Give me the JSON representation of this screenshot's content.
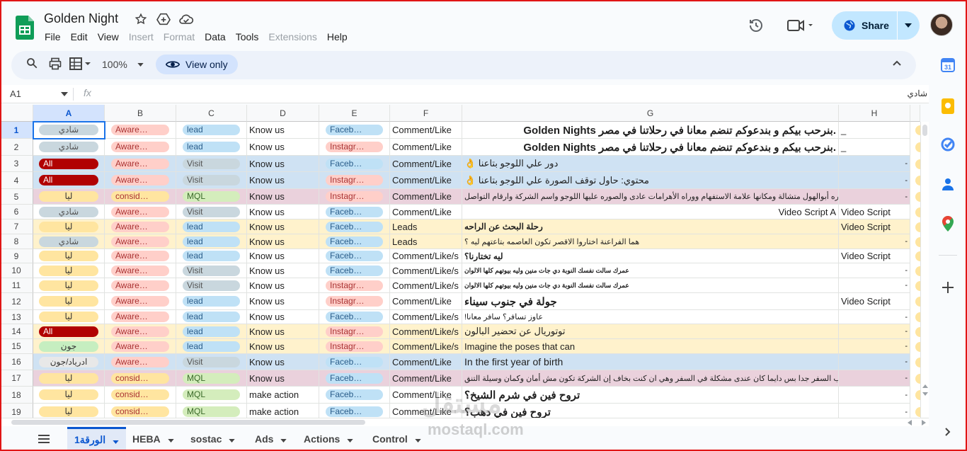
{
  "app": {
    "doc_title": "Golden Night",
    "menu": [
      {
        "label": "File",
        "disabled": false
      },
      {
        "label": "Edit",
        "disabled": false
      },
      {
        "label": "View",
        "disabled": false
      },
      {
        "label": "Insert",
        "disabled": true
      },
      {
        "label": "Format",
        "disabled": true
      },
      {
        "label": "Data",
        "disabled": false
      },
      {
        "label": "Tools",
        "disabled": false
      },
      {
        "label": "Extensions",
        "disabled": true
      },
      {
        "label": "Help",
        "disabled": false
      }
    ],
    "share_label": "Share"
  },
  "toolbar": {
    "zoom": "100%",
    "view_only_label": "View only"
  },
  "formula_bar": {
    "cell_ref": "A1",
    "fx": "fx",
    "value": "شادي"
  },
  "columns": [
    "A",
    "B",
    "C",
    "D",
    "E",
    "F",
    "G",
    "H"
  ],
  "rows": [
    {
      "n": "1",
      "a": "شادي",
      "b": "Aware…",
      "c": "lead",
      "d": "Know us",
      "e": "Faceb…",
      "f": "Comment/Like",
      "g": "Golden Nights بنرحب بيكم و بندعوكم تنضم معانا في رحلاتنا في مصر.",
      "g_style": "bold",
      "h": "_"
    },
    {
      "n": "2",
      "a": "شادي",
      "b": "Aware…",
      "c": "lead",
      "d": "Know us",
      "e": "Instagr…",
      "f": "Comment/Like",
      "g": "Golden Nights بنرحب بيكم و بندعوكم تنضم معانا في رحلاتنا في مصر.",
      "g_style": "bold",
      "h": "_"
    },
    {
      "n": "3",
      "a": "All",
      "b": "Aware…",
      "c": "Visit",
      "d": "Know us",
      "e": "Faceb…",
      "f": "Comment/Like",
      "g": "دور علي اللوجو بتاعنا 👌",
      "g_style": "normal",
      "h": "-"
    },
    {
      "n": "4",
      "a": "All",
      "b": "Aware…",
      "c": "Visit",
      "d": "Know us",
      "e": "Instagr…",
      "f": "Comment/Like",
      "g": "محتوي: حاول توقف الصورة علي اللوجو بتاعنا 👌",
      "g_style": "normal",
      "h": "-"
    },
    {
      "n": "5",
      "a": "ليا",
      "b": "consid…",
      "c": "MQL",
      "d": "Know us",
      "e": "Instagr…",
      "f": "Comment/Like",
      "g": "صوره أبوالهول متشالة ومكانها علامة الاستفهام ووراه الأهرامات عادى والصوره عليها اللوجو واسم الشركة وارقام التواصل",
      "g_style": "small",
      "h": "-"
    },
    {
      "n": "6",
      "a": "شادي",
      "b": "Aware…",
      "c": "Visit",
      "d": "Know us",
      "e": "Faceb…",
      "f": "Comment/Like",
      "g": "Video Script A",
      "g_style": "normal",
      "h": "Video Script"
    },
    {
      "n": "7",
      "a": "ليا",
      "b": "Aware…",
      "c": "lead",
      "d": "Know us",
      "e": "Faceb…",
      "f": "Leads",
      "g": "رحلة البحث عن الراحه",
      "g_style": "boldsmall",
      "h": "Video Script",
      "g_align": "left"
    },
    {
      "n": "8",
      "a": "شادي",
      "b": "Aware…",
      "c": "lead",
      "d": "Know us",
      "e": "Faceb…",
      "f": "Leads",
      "g": "هما الفراعنة اختاروا الاقصر تكون العاصمه بتاعتهم ليه ؟",
      "g_style": "small",
      "h": "-",
      "g_align": "left"
    },
    {
      "n": "9",
      "a": "ليا",
      "b": "Aware…",
      "c": "lead",
      "d": "Know us",
      "e": "Faceb…",
      "f": "Comment/Like/s",
      "g": "ليه تختارنا؟",
      "g_style": "boldsmall",
      "h": "Video Script"
    },
    {
      "n": "10",
      "a": "ليا",
      "b": "Aware…",
      "c": "Visit",
      "d": "Know us",
      "e": "Faceb…",
      "f": "Comment/Like/s",
      "g": "عمرك سالت نفسك النوبة دي جات منين وليه بيوتهم كلها الالوان",
      "g_style": "tiny",
      "h": "-"
    },
    {
      "n": "11",
      "a": "ليا",
      "b": "Aware…",
      "c": "Visit",
      "d": "Know us",
      "e": "Instagr…",
      "f": "Comment/Like/s",
      "g": "عمرك سالت نفسك النوبة دي جات منين وليه بيوتهم كلها الالوان",
      "g_style": "tiny",
      "h": "-"
    },
    {
      "n": "12",
      "a": "ليا",
      "b": "Aware…",
      "c": "lead",
      "d": "Know us",
      "e": "Instagr…",
      "f": "Comment/Like",
      "g": "جولة في جنوب سيناء",
      "g_style": "bold",
      "h": "Video Script"
    },
    {
      "n": "13",
      "a": "ليا",
      "b": "Aware…",
      "c": "lead",
      "d": "Know us",
      "e": "Faceb…",
      "f": "Comment/Like/s",
      "g": "عاوز تسافر؟ سافر معانا!",
      "g_style": "small",
      "h": "-"
    },
    {
      "n": "14",
      "a": "All",
      "b": "Aware…",
      "c": "lead",
      "d": "Know us",
      "e": "Instagr…",
      "f": "Comment/Like/s",
      "g": "توتوريال عن تحضير البالون",
      "g_style": "normal",
      "h": "-",
      "g_align": "left"
    },
    {
      "n": "15",
      "a": "جون",
      "b": "Aware…",
      "c": "lead",
      "d": "Know us",
      "e": "Instagr…",
      "f": "Comment/Like/s",
      "g": "Imagine the poses that can",
      "g_style": "normal",
      "h": "-",
      "g_align": "left"
    },
    {
      "n": "16",
      "a": "ادرياد/جون",
      "b": "Aware…",
      "c": "Visit",
      "d": "Know us",
      "e": "Faceb…",
      "f": "Comment/Like",
      "g": "In the first year of birth",
      "g_style": "large",
      "h": "-",
      "g_align": "left"
    },
    {
      "n": "17",
      "a": "ليا",
      "b": "consid…",
      "c": "MQL",
      "d": "Know us",
      "e": "Faceb…",
      "f": "Comment/Like",
      "g": "أنا ندى بحب السفر جدا بس دايما كان عندى مشكلة في السفر وهي ان كنت بخاف إن الشركة تكون مش أمان وكمان وسيلة التنق",
      "g_style": "small",
      "h": "-"
    },
    {
      "n": "18",
      "a": "ليا",
      "b": "consid…",
      "c": "MQL",
      "d": "make action",
      "e": "Faceb…",
      "f": "Comment/Like",
      "g": "تروح فين في شرم الشيخ؟",
      "g_style": "bold",
      "h": "-"
    },
    {
      "n": "19",
      "a": "ليا",
      "b": "consid…",
      "c": "MQL",
      "d": "make action",
      "e": "Faceb…",
      "f": "Comment/Like",
      "g": "تروح فين في دهب؟",
      "g_style": "bold",
      "h": "-"
    }
  ],
  "sheet_tabs": [
    {
      "label": "الورقة1",
      "active": true
    },
    {
      "label": "HEBA",
      "active": false
    },
    {
      "label": "sostac",
      "active": false
    },
    {
      "label": "Ads",
      "active": false
    },
    {
      "label": "Actions",
      "active": false
    },
    {
      "label": "Control",
      "active": false
    }
  ],
  "watermark": {
    "arabic": "مستقل",
    "latin": "mostaql.com"
  },
  "colors": {
    "accent": "#0b57d0",
    "share_bg": "#c2e7ff",
    "chip_person_grey": "#c9d7de",
    "chip_person_yellow": "#ffe5a0",
    "chip_person_green": "#c6eec0",
    "chip_all": "#b10202",
    "chip_aware": "#ffcfc9",
    "chip_consid": "#ffe5a0",
    "chip_lead": "#bfe1f6",
    "chip_visit": "#c9d7de",
    "chip_mql": "#d4edbc",
    "chip_facebook": "#bfe1f6",
    "chip_instagram": "#ffcfc9",
    "row_blue": "#cfe2f3",
    "row_pink": "#ead1dc",
    "row_yellow": "#fff2cc"
  }
}
